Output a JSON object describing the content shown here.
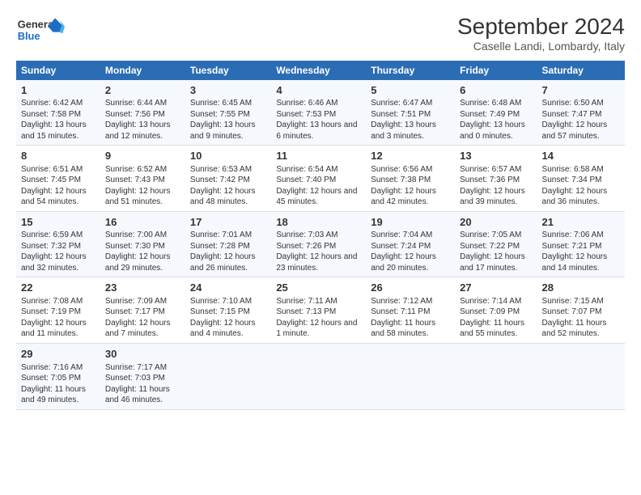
{
  "header": {
    "logo_line1": "General",
    "logo_line2": "Blue",
    "title": "September 2024",
    "subtitle": "Caselle Landi, Lombardy, Italy"
  },
  "days_of_week": [
    "Sunday",
    "Monday",
    "Tuesday",
    "Wednesday",
    "Thursday",
    "Friday",
    "Saturday"
  ],
  "weeks": [
    [
      {
        "day": "1",
        "sunrise": "6:42 AM",
        "sunset": "7:58 PM",
        "daylight": "13 hours and 15 minutes."
      },
      {
        "day": "2",
        "sunrise": "6:44 AM",
        "sunset": "7:56 PM",
        "daylight": "13 hours and 12 minutes."
      },
      {
        "day": "3",
        "sunrise": "6:45 AM",
        "sunset": "7:55 PM",
        "daylight": "13 hours and 9 minutes."
      },
      {
        "day": "4",
        "sunrise": "6:46 AM",
        "sunset": "7:53 PM",
        "daylight": "13 hours and 6 minutes."
      },
      {
        "day": "5",
        "sunrise": "6:47 AM",
        "sunset": "7:51 PM",
        "daylight": "13 hours and 3 minutes."
      },
      {
        "day": "6",
        "sunrise": "6:48 AM",
        "sunset": "7:49 PM",
        "daylight": "13 hours and 0 minutes."
      },
      {
        "day": "7",
        "sunrise": "6:50 AM",
        "sunset": "7:47 PM",
        "daylight": "12 hours and 57 minutes."
      }
    ],
    [
      {
        "day": "8",
        "sunrise": "6:51 AM",
        "sunset": "7:45 PM",
        "daylight": "12 hours and 54 minutes."
      },
      {
        "day": "9",
        "sunrise": "6:52 AM",
        "sunset": "7:43 PM",
        "daylight": "12 hours and 51 minutes."
      },
      {
        "day": "10",
        "sunrise": "6:53 AM",
        "sunset": "7:42 PM",
        "daylight": "12 hours and 48 minutes."
      },
      {
        "day": "11",
        "sunrise": "6:54 AM",
        "sunset": "7:40 PM",
        "daylight": "12 hours and 45 minutes."
      },
      {
        "day": "12",
        "sunrise": "6:56 AM",
        "sunset": "7:38 PM",
        "daylight": "12 hours and 42 minutes."
      },
      {
        "day": "13",
        "sunrise": "6:57 AM",
        "sunset": "7:36 PM",
        "daylight": "12 hours and 39 minutes."
      },
      {
        "day": "14",
        "sunrise": "6:58 AM",
        "sunset": "7:34 PM",
        "daylight": "12 hours and 36 minutes."
      }
    ],
    [
      {
        "day": "15",
        "sunrise": "6:59 AM",
        "sunset": "7:32 PM",
        "daylight": "12 hours and 32 minutes."
      },
      {
        "day": "16",
        "sunrise": "7:00 AM",
        "sunset": "7:30 PM",
        "daylight": "12 hours and 29 minutes."
      },
      {
        "day": "17",
        "sunrise": "7:01 AM",
        "sunset": "7:28 PM",
        "daylight": "12 hours and 26 minutes."
      },
      {
        "day": "18",
        "sunrise": "7:03 AM",
        "sunset": "7:26 PM",
        "daylight": "12 hours and 23 minutes."
      },
      {
        "day": "19",
        "sunrise": "7:04 AM",
        "sunset": "7:24 PM",
        "daylight": "12 hours and 20 minutes."
      },
      {
        "day": "20",
        "sunrise": "7:05 AM",
        "sunset": "7:22 PM",
        "daylight": "12 hours and 17 minutes."
      },
      {
        "day": "21",
        "sunrise": "7:06 AM",
        "sunset": "7:21 PM",
        "daylight": "12 hours and 14 minutes."
      }
    ],
    [
      {
        "day": "22",
        "sunrise": "7:08 AM",
        "sunset": "7:19 PM",
        "daylight": "12 hours and 11 minutes."
      },
      {
        "day": "23",
        "sunrise": "7:09 AM",
        "sunset": "7:17 PM",
        "daylight": "12 hours and 7 minutes."
      },
      {
        "day": "24",
        "sunrise": "7:10 AM",
        "sunset": "7:15 PM",
        "daylight": "12 hours and 4 minutes."
      },
      {
        "day": "25",
        "sunrise": "7:11 AM",
        "sunset": "7:13 PM",
        "daylight": "12 hours and 1 minute."
      },
      {
        "day": "26",
        "sunrise": "7:12 AM",
        "sunset": "7:11 PM",
        "daylight": "11 hours and 58 minutes."
      },
      {
        "day": "27",
        "sunrise": "7:14 AM",
        "sunset": "7:09 PM",
        "daylight": "11 hours and 55 minutes."
      },
      {
        "day": "28",
        "sunrise": "7:15 AM",
        "sunset": "7:07 PM",
        "daylight": "11 hours and 52 minutes."
      }
    ],
    [
      {
        "day": "29",
        "sunrise": "7:16 AM",
        "sunset": "7:05 PM",
        "daylight": "11 hours and 49 minutes."
      },
      {
        "day": "30",
        "sunrise": "7:17 AM",
        "sunset": "7:03 PM",
        "daylight": "11 hours and 46 minutes."
      },
      null,
      null,
      null,
      null,
      null
    ]
  ],
  "labels": {
    "sunrise": "Sunrise:",
    "sunset": "Sunset:",
    "daylight": "Daylight:"
  }
}
